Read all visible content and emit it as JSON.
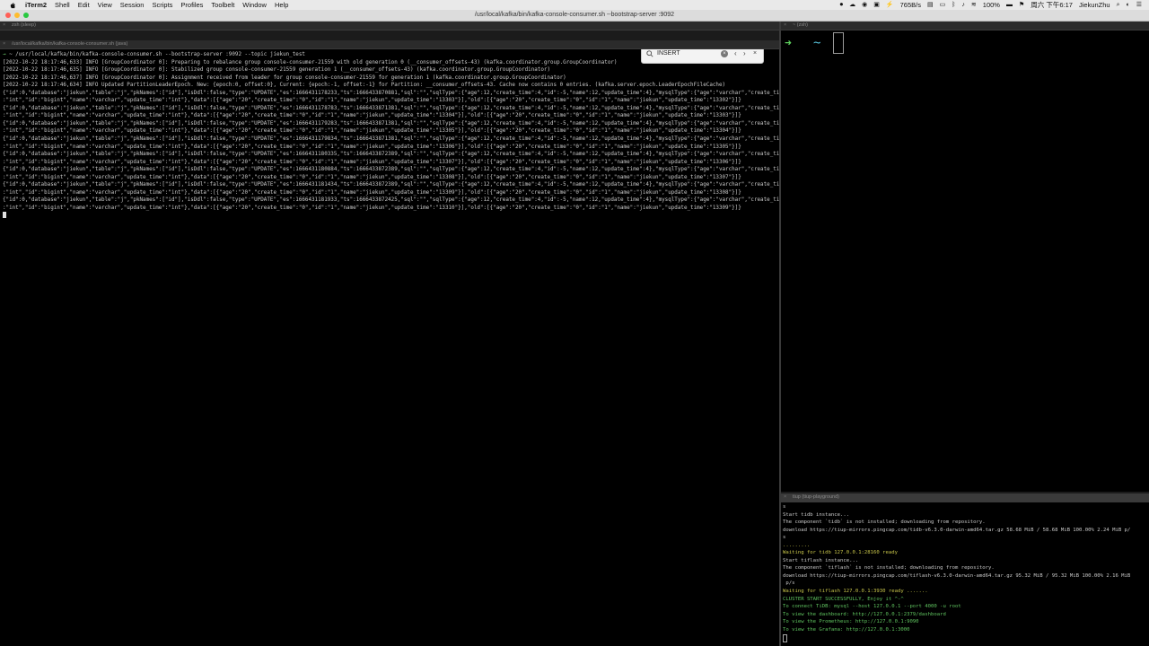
{
  "menubar": {
    "items": [
      "iTerm2",
      "Shell",
      "Edit",
      "View",
      "Session",
      "Scripts",
      "Profiles",
      "Toolbelt",
      "Window",
      "Help"
    ],
    "right_status": [
      "765B/s",
      "100%",
      "周六 下午6:17",
      "JiekunZhu"
    ]
  },
  "window": {
    "title": "/usr/local/kafka/bin/kafka-console-consumer.sh --bootstrap-server :9092"
  },
  "tabs": {
    "left": "/usr/local/kafka/bin/kafka-console-consumer.sh (java)",
    "top_strip": "zsh (sleep)",
    "right_top": "~ (zsh)",
    "right_bottom": "tiup (tiup-playground)"
  },
  "search": {
    "value": "INSERT"
  },
  "left_terminal": {
    "lines": [
      "→ ~ /usr/local/kafka/bin/kafka-console-consumer.sh --bootstrap-server :9092 --topic jiekun_test",
      "[2022-10-22 18:17:46,633] INFO [GroupCoordinator 0]: Preparing to rebalance group console-consumer-21559 with old generation 0 (__consumer_offsets-43) (kafka.coordinator.group.GroupCoordinator)",
      "[2022-10-22 18:17:46,635] INFO [GroupCoordinator 0]: Stabilized group console-consumer-21559 generation 1 (__consumer_offsets-43) (kafka.coordinator.group.GroupCoordinator)",
      "[2022-10-22 18:17:46,637] INFO [GroupCoordinator 0]: Assignment received from leader for group console-consumer-21559 for generation 1 (kafka.coordinator.group.GroupCoordinator)",
      "[2022-10-22 18:17:46,634] INFO Updated PartitionLeaderEpoch. New: {epoch:0, offset:0}, Current: {epoch:-1, offset:-1} for Partition: __consumer_offsets-43. Cache now contains 0 entries. (kafka.server.epoch.LeaderEpochFileCache)",
      "{\"id\":0,\"database\":\"jiekun\",\"table\":\"j\",\"pkNames\":[\"id\"],\"isDdl\":false,\"type\":\"UPDATE\",\"es\":1666431178233,\"ts\":1666433870881,\"sql\":\"\",\"sqlType\":{\"age\":12,\"create_time\":4,\"id\":-5,\"name\":12,\"update_time\":4},\"mysqlType\":{\"age\":\"varchar\",\"create_time\"",
      ":\"int\",\"id\":\"bigint\",\"name\":\"varchar\",\"update_time\":\"int\"},\"data\":[{\"age\":\"20\",\"create_time\":\"0\",\"id\":\"1\",\"name\":\"jiekun\",\"update_time\":\"13303\"}],\"old\":[{\"age\":\"20\",\"create_time\":\"0\",\"id\":\"1\",\"name\":\"jiekun\",\"update_time\":\"13302\"}]}",
      "{\"id\":0,\"database\":\"jiekun\",\"table\":\"j\",\"pkNames\":[\"id\"],\"isDdl\":false,\"type\":\"UPDATE\",\"es\":1666431178783,\"ts\":1666433871381,\"sql\":\"\",\"sqlType\":{\"age\":12,\"create_time\":4,\"id\":-5,\"name\":12,\"update_time\":4},\"mysqlType\":{\"age\":\"varchar\",\"create_time\"",
      ":\"int\",\"id\":\"bigint\",\"name\":\"varchar\",\"update_time\":\"int\"},\"data\":[{\"age\":\"20\",\"create_time\":\"0\",\"id\":\"1\",\"name\":\"jiekun\",\"update_time\":\"13304\"}],\"old\":[{\"age\":\"20\",\"create_time\":\"0\",\"id\":\"1\",\"name\":\"jiekun\",\"update_time\":\"13303\"}]}",
      "{\"id\":0,\"database\":\"jiekun\",\"table\":\"j\",\"pkNames\":[\"id\"],\"isDdl\":false,\"type\":\"UPDATE\",\"es\":1666431179283,\"ts\":1666433871381,\"sql\":\"\",\"sqlType\":{\"age\":12,\"create_time\":4,\"id\":-5,\"name\":12,\"update_time\":4},\"mysqlType\":{\"age\":\"varchar\",\"create_time\"",
      ":\"int\",\"id\":\"bigint\",\"name\":\"varchar\",\"update_time\":\"int\"},\"data\":[{\"age\":\"20\",\"create_time\":\"0\",\"id\":\"1\",\"name\":\"jiekun\",\"update_time\":\"13305\"}],\"old\":[{\"age\":\"20\",\"create_time\":\"0\",\"id\":\"1\",\"name\":\"jiekun\",\"update_time\":\"13304\"}]}",
      "{\"id\":0,\"database\":\"jiekun\",\"table\":\"j\",\"pkNames\":[\"id\"],\"isDdl\":false,\"type\":\"UPDATE\",\"es\":1666431179834,\"ts\":1666433871381,\"sql\":\"\",\"sqlType\":{\"age\":12,\"create_time\":4,\"id\":-5,\"name\":12,\"update_time\":4},\"mysqlType\":{\"age\":\"varchar\",\"create_time\"",
      ":\"int\",\"id\":\"bigint\",\"name\":\"varchar\",\"update_time\":\"int\"},\"data\":[{\"age\":\"20\",\"create_time\":\"0\",\"id\":\"1\",\"name\":\"jiekun\",\"update_time\":\"13306\"}],\"old\":[{\"age\":\"20\",\"create_time\":\"0\",\"id\":\"1\",\"name\":\"jiekun\",\"update_time\":\"13305\"}]}",
      "{\"id\":0,\"database\":\"jiekun\",\"table\":\"j\",\"pkNames\":[\"id\"],\"isDdl\":false,\"type\":\"UPDATE\",\"es\":1666431180335,\"ts\":1666433872389,\"sql\":\"\",\"sqlType\":{\"age\":12,\"create_time\":4,\"id\":-5,\"name\":12,\"update_time\":4},\"mysqlType\":{\"age\":\"varchar\",\"create_time\"",
      ":\"int\",\"id\":\"bigint\",\"name\":\"varchar\",\"update_time\":\"int\"},\"data\":[{\"age\":\"20\",\"create_time\":\"0\",\"id\":\"1\",\"name\":\"jiekun\",\"update_time\":\"13307\"}],\"old\":[{\"age\":\"20\",\"create_time\":\"0\",\"id\":\"1\",\"name\":\"jiekun\",\"update_time\":\"13306\"}]}",
      "{\"id\":0,\"database\":\"jiekun\",\"table\":\"j\",\"pkNames\":[\"id\"],\"isDdl\":false,\"type\":\"UPDATE\",\"es\":1666431180884,\"ts\":1666433872389,\"sql\":\"\",\"sqlType\":{\"age\":12,\"create_time\":4,\"id\":-5,\"name\":12,\"update_time\":4},\"mysqlType\":{\"age\":\"varchar\",\"create_time\"",
      ":\"int\",\"id\":\"bigint\",\"name\":\"varchar\",\"update_time\":\"int\"},\"data\":[{\"age\":\"20\",\"create_time\":\"0\",\"id\":\"1\",\"name\":\"jiekun\",\"update_time\":\"13308\"}],\"old\":[{\"age\":\"20\",\"create_time\":\"0\",\"id\":\"1\",\"name\":\"jiekun\",\"update_time\":\"13307\"}]}",
      "{\"id\":0,\"database\":\"jiekun\",\"table\":\"j\",\"pkNames\":[\"id\"],\"isDdl\":false,\"type\":\"UPDATE\",\"es\":1666431181434,\"ts\":1666433872389,\"sql\":\"\",\"sqlType\":{\"age\":12,\"create_time\":4,\"id\":-5,\"name\":12,\"update_time\":4},\"mysqlType\":{\"age\":\"varchar\",\"create_time\"",
      ":\"int\",\"id\":\"bigint\",\"name\":\"varchar\",\"update_time\":\"int\"},\"data\":[{\"age\":\"20\",\"create_time\":\"0\",\"id\":\"1\",\"name\":\"jiekun\",\"update_time\":\"13309\"}],\"old\":[{\"age\":\"20\",\"create_time\":\"0\",\"id\":\"1\",\"name\":\"jiekun\",\"update_time\":\"13308\"}]}",
      "{\"id\":0,\"database\":\"jiekun\",\"table\":\"j\",\"pkNames\":[\"id\"],\"isDdl\":false,\"type\":\"UPDATE\",\"es\":1666431181933,\"ts\":1666433872425,\"sql\":\"\",\"sqlType\":{\"age\":12,\"create_time\":4,\"id\":-5,\"name\":12,\"update_time\":4},\"mysqlType\":{\"age\":\"varchar\",\"create_time\"",
      ":\"int\",\"id\":\"bigint\",\"name\":\"varchar\",\"update_time\":\"int\"},\"data\":[{\"age\":\"20\",\"create_time\":\"0\",\"id\":\"1\",\"name\":\"jiekun\",\"update_time\":\"13310\"}],\"old\":[{\"age\":\"20\",\"create_time\":\"0\",\"id\":\"1\",\"name\":\"jiekun\",\"update_time\":\"13309\"}]}"
    ]
  },
  "right_top_terminal": {
    "prompt_symbol": "➜",
    "cwd": "~"
  },
  "right_bottom_terminal": {
    "lines": [
      {
        "text": "s",
        "color": "#c8c8c8"
      },
      {
        "text": "Start tidb instance...",
        "color": "#c8c8c8"
      },
      {
        "text": "The component `tidb` is not installed; downloading from repository.",
        "color": "#c8c8c8"
      },
      {
        "text": "download https://tiup-mirrors.pingcap.com/tidb-v6.3.0-darwin-amd64.tar.gz 58.68 MiB / 58.68 MiB 100.00% 2.24 MiB p/",
        "color": "#c8c8c8"
      },
      {
        "text": "s",
        "color": "#c8c8c8"
      },
      {
        "text": ".........",
        "color": "#c8c54a"
      },
      {
        "text": "Waiting for tidb 127.0.0.1:28160 ready",
        "color": "#c8c54a"
      },
      {
        "text": "Start tiflash instance...",
        "color": "#c8c8c8"
      },
      {
        "text": "The component `tiflash` is not installed; downloading from repository.",
        "color": "#c8c8c8"
      },
      {
        "text": "download https://tiup-mirrors.pingcap.com/tiflash-v6.3.0-darwin-amd64.tar.gz 95.32 MiB / 95.32 MiB 100.00% 2.16 MiB",
        "color": "#c8c8c8"
      },
      {
        "text": " p/s",
        "color": "#c8c8c8"
      },
      {
        "text": "Waiting for tiflash 127.0.0.1:3930 ready .......",
        "color": "#c8c54a"
      },
      {
        "text": "CLUSTER START SUCCESSFULLY, Enjoy it ^-^",
        "color": "#5fc35f"
      },
      {
        "text": "To connect TiDB: mysql --host 127.0.0.1 --port 4000 -u root",
        "color": "#5fc35f"
      },
      {
        "text": "To view the dashboard: http://127.0.0.1:2379/dashboard",
        "color": "#5fc35f"
      },
      {
        "text": "To view the Prometheus: http://127.0.0.1:9090",
        "color": "#5fc35f"
      },
      {
        "text": "To view the Grafana: http://127.0.0.1:3000",
        "color": "#5fc35f"
      }
    ]
  },
  "colors": {
    "prompt_green": "#6fd06f",
    "tilde_cyan": "#58c4dc",
    "warn_yellow": "#c8c54a",
    "ok_green": "#5fc35f"
  }
}
